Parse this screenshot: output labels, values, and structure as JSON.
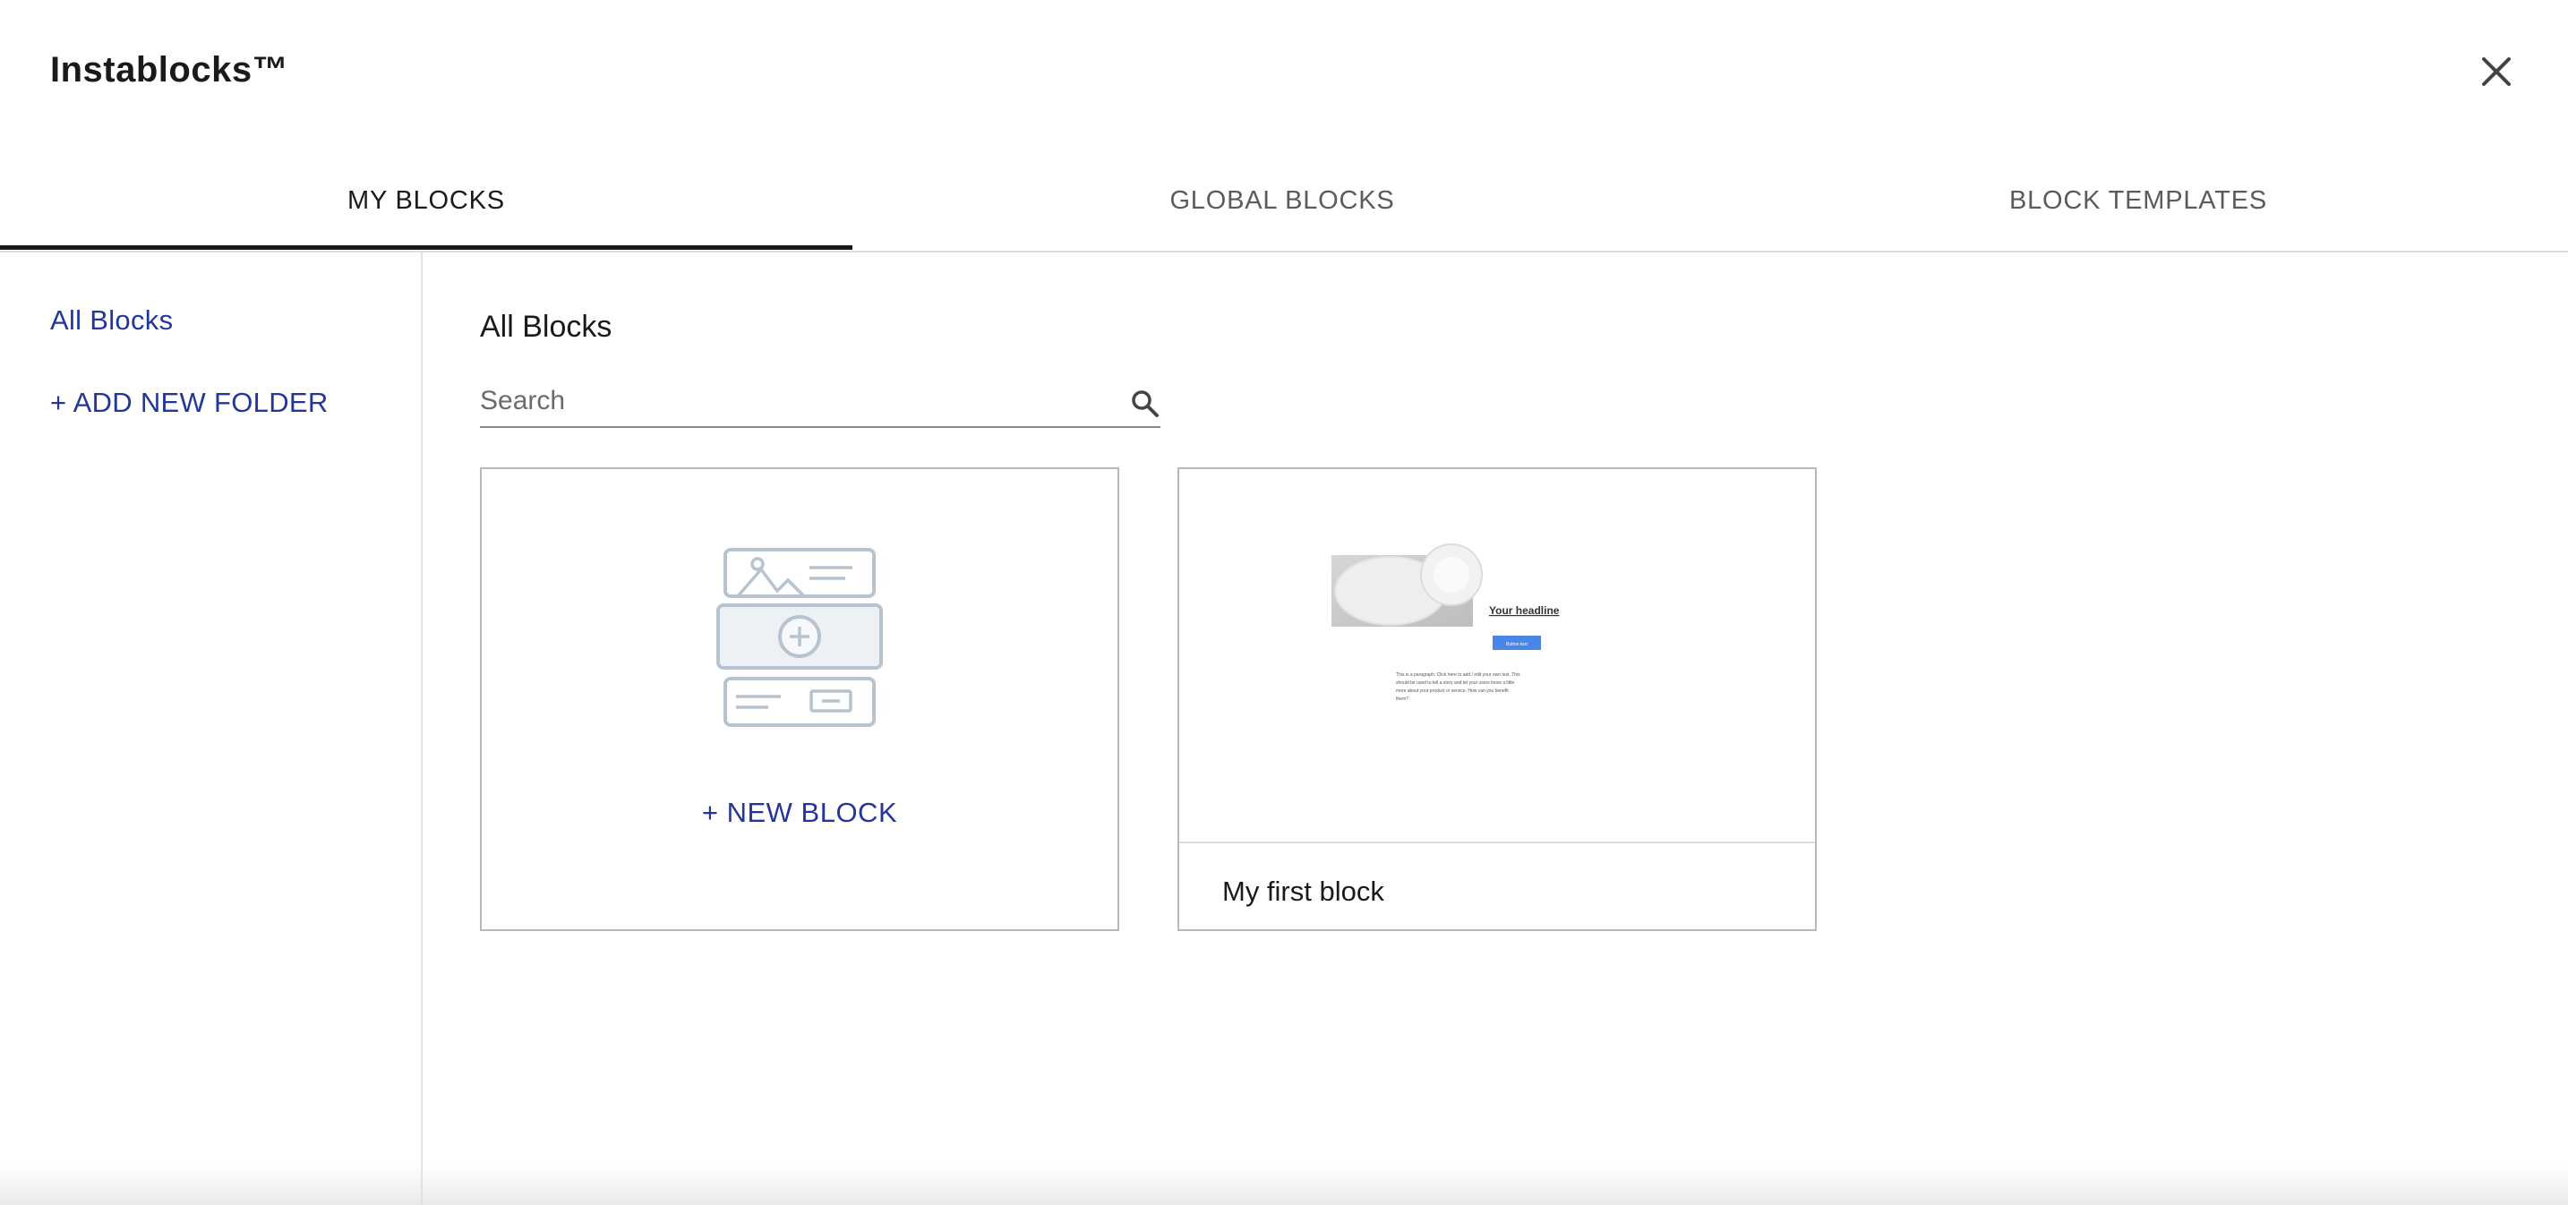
{
  "modal": {
    "title": "Instablocks™"
  },
  "tabs": [
    {
      "label": "MY BLOCKS",
      "active": true
    },
    {
      "label": "GLOBAL BLOCKS",
      "active": false
    },
    {
      "label": "BLOCK TEMPLATES",
      "active": false
    }
  ],
  "sidebar": {
    "all_blocks": "All Blocks",
    "add_folder": "+ ADD NEW FOLDER"
  },
  "main": {
    "section_title": "All Blocks",
    "search": {
      "placeholder": "Search",
      "value": ""
    },
    "new_block_label": "+ NEW BLOCK",
    "blocks": [
      {
        "name": "My first block",
        "preview": {
          "headline": "Your headline",
          "button_text": "Button text",
          "paragraph": "This is a paragraph. Click here to add / edit your own text. This should be used to tell a story and let your users know a little more about your product or service. How can you benefit them?"
        }
      }
    ]
  },
  "colors": {
    "accent": "#23379a",
    "text": "#1a1a1a",
    "preview_button": "#4a86e8"
  },
  "icons": {
    "close": "close-icon",
    "search": "search-icon",
    "new_block": "new-block-illustration"
  }
}
